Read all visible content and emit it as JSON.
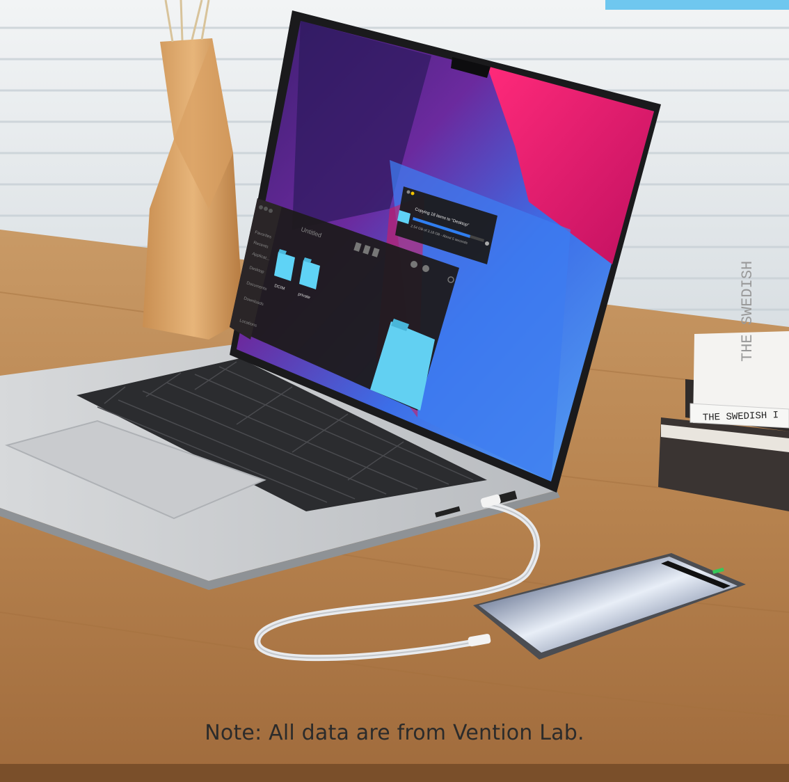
{
  "note": "Note: All data are from Vention Lab.",
  "copy_dialog": {
    "title": "Copying 18 items to \"Desktop\"",
    "detail": "2.54 GB of 3.18 GB - About 5 seconds",
    "progress": 0.8
  },
  "finder": {
    "window_title": "Untitled",
    "sidebar_items": [
      "Favorites",
      "Recents",
      "Applicat...",
      "Desktop",
      "Documents",
      "Downloads",
      "Locations"
    ],
    "folders": [
      {
        "label": "DCIM"
      },
      {
        "label": "private"
      }
    ]
  },
  "book": {
    "spine_text": "THE SWEDISH I",
    "cover_text": "THE SWEDISH"
  },
  "colors": {
    "desk": "#b98753",
    "folder_blue": "#5fd3f6",
    "wallpaper_magenta": "#e0176a",
    "wallpaper_blue": "#2f7ef0"
  }
}
